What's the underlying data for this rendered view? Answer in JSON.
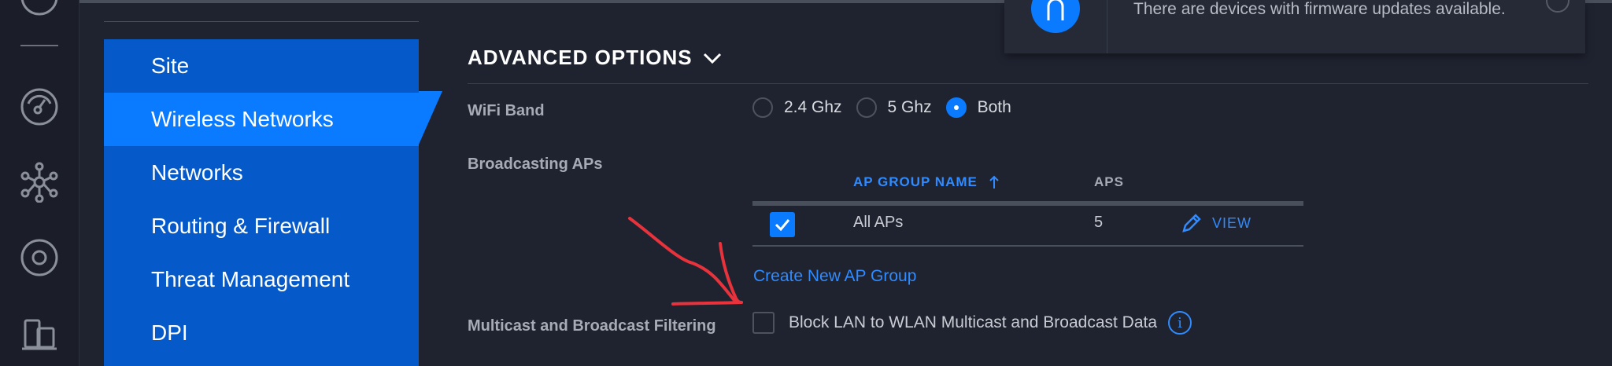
{
  "rail": {
    "icons": [
      "divider",
      "dashboard-icon",
      "topology-icon",
      "target-icon",
      "devices-icon"
    ]
  },
  "subnav": {
    "items": [
      {
        "label": "Site",
        "active": false
      },
      {
        "label": "Wireless Networks",
        "active": true
      },
      {
        "label": "Networks",
        "active": false
      },
      {
        "label": "Routing & Firewall",
        "active": false
      },
      {
        "label": "Threat Management",
        "active": false
      },
      {
        "label": "DPI",
        "active": false
      }
    ]
  },
  "toast": {
    "message": "There are devices with firmware updates available.",
    "icon": "bell-icon"
  },
  "advanced": {
    "title": "ADVANCED OPTIONS",
    "wifi_band": {
      "label": "WiFi Band",
      "options": [
        "2.4 Ghz",
        "5 Ghz",
        "Both"
      ],
      "selected": "Both"
    },
    "broadcasting": {
      "label": "Broadcasting APs",
      "table": {
        "col_name": "AP GROUP NAME",
        "col_aps": "APS",
        "rows": [
          {
            "checked": true,
            "name": "All APs",
            "aps": "5",
            "action": "VIEW"
          }
        ]
      },
      "create_link": "Create New AP Group"
    },
    "multicast": {
      "label": "Multicast and Broadcast Filtering",
      "checkbox_label": "Block LAN to WLAN Multicast and Broadcast Data",
      "checked": false
    }
  },
  "colors": {
    "accent": "#0a7bff",
    "subnav": "#0559c9",
    "background": "#1f2330",
    "annotation": "#e8323c"
  }
}
